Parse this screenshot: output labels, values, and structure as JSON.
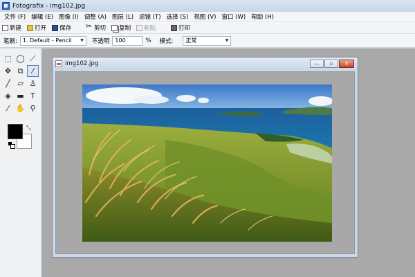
{
  "app": {
    "title": "Fotografix - img102.jpg"
  },
  "menu": [
    "文件 (F)",
    "编辑 (E)",
    "图像 (I)",
    "调整 (A)",
    "图层 (L)",
    "滤镜 (T)",
    "选择 (S)",
    "视图 (V)",
    "窗口 (W)",
    "帮助 (H)"
  ],
  "toolbar": {
    "new": "新建",
    "open": "打开",
    "save": "保存",
    "cut": "剪切",
    "copy": "复制",
    "paste": "粘贴",
    "print": "打印"
  },
  "options": {
    "brush_label": "笔刷:",
    "brush_value": "1. Default - Pencil",
    "opacity_label": "不透明",
    "opacity_value": "100",
    "percent": "%",
    "mode_label": "模式:",
    "mode_value": "正常"
  },
  "tools": [
    {
      "icon": "rect-select-icon",
      "glyph": "⬚"
    },
    {
      "icon": "ellipse-select-icon",
      "glyph": "◯"
    },
    {
      "icon": "line-icon",
      "glyph": "⟋"
    },
    {
      "icon": "move-icon",
      "glyph": "✥"
    },
    {
      "icon": "crop-icon",
      "glyph": "⧉"
    },
    {
      "icon": "magic-wand-icon",
      "glyph": "⁄"
    },
    {
      "icon": "brush-icon",
      "glyph": "╱"
    },
    {
      "icon": "eraser-icon",
      "glyph": "▱"
    },
    {
      "icon": "clone-stamp-icon",
      "glyph": "♙"
    },
    {
      "icon": "paint-bucket-icon",
      "glyph": "◈"
    },
    {
      "icon": "gradient-icon",
      "glyph": "▬"
    },
    {
      "icon": "text-icon",
      "glyph": "T"
    },
    {
      "icon": "eyedropper-icon",
      "glyph": "⁄"
    },
    {
      "icon": "hand-icon",
      "glyph": "✋"
    },
    {
      "icon": "zoom-icon",
      "glyph": "⚲"
    }
  ],
  "colors": {
    "foreground": "#000000",
    "background": "#ffffff"
  },
  "document": {
    "title": "img102.jpg",
    "minimize": "—",
    "maximize": "▫",
    "close": "✕"
  }
}
